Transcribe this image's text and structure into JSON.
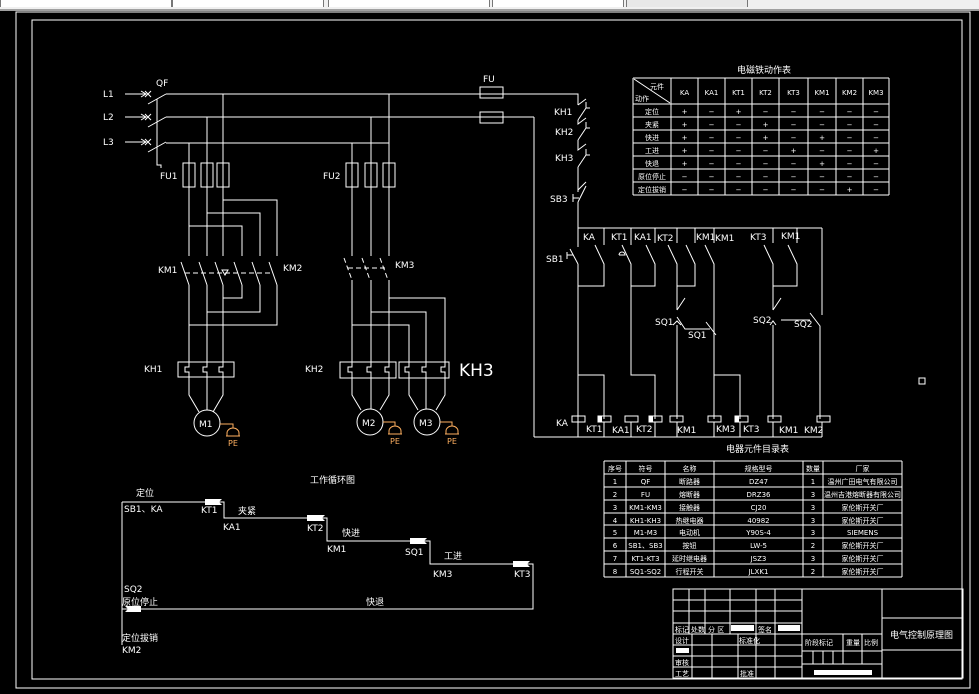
{
  "colors": {
    "background": "#000000",
    "lines": "#ffffff",
    "earth": "#ffb060",
    "toolbar": "#f0f0f0"
  },
  "power_circuit": {
    "L1": "L1",
    "L2": "L2",
    "L3": "L3",
    "QF": "QF",
    "FU1": "FU1",
    "FU2": "FU2",
    "FU": "FU",
    "KM1": "KM1",
    "KM2": "KM2",
    "KM3": "KM3",
    "KH1": "KH1",
    "KH2": "KH2",
    "KH3": "KH3",
    "M1": "M1",
    "M2": "M2",
    "M3": "M3",
    "PE": "PE"
  },
  "control_circuit": {
    "KH1": "KH1",
    "KH2": "KH2",
    "KH3": "KH3",
    "SB3": "SB3",
    "SB1": "SB1",
    "top_contacts": [
      "KA",
      "KT1",
      "KA1",
      "KT2",
      "KM1",
      "KM1",
      "KT3",
      "KM1"
    ],
    "SQ1": "SQ1",
    "SQ1b": "SQ1",
    "SQ2": "SQ2",
    "SQ2b": "SQ2",
    "coils": [
      "KA",
      "KT1",
      "KA1",
      "KT2",
      "KM1",
      "KM3",
      "KT3",
      "KM1",
      "KM2"
    ]
  },
  "cycle_diagram": {
    "title": "工作循环图",
    "labels": {
      "s1": "定位",
      "s1_in": "SB1、KA",
      "s1_out": "KT1",
      "s2": "夹紧",
      "s2_in": "KA1",
      "s2_out": "KT2",
      "s3": "快进",
      "s3_in": "KM1",
      "s3_out": "SQ1",
      "s4": "工进",
      "s4_in": "KM3",
      "s4_out": "KT3",
      "ret_in": "SQ2",
      "stop": "原位停止",
      "ret": "快退",
      "pull": "定位拔销",
      "pull_in": "KM2"
    }
  },
  "action_table": {
    "title": "电磁铁动作表",
    "corner_top": "元件",
    "corner_bottom": "动作",
    "columns": [
      "KA",
      "KA1",
      "KT1",
      "KT2",
      "KT3",
      "KM1",
      "KM2",
      "KM3"
    ],
    "rows": [
      {
        "action": "定位",
        "values": [
          "+",
          "−",
          "+",
          "−",
          "−",
          "−",
          "−",
          "−"
        ]
      },
      {
        "action": "夹紧",
        "values": [
          "+",
          "−",
          "−",
          "+",
          "−",
          "−",
          "−",
          "−"
        ]
      },
      {
        "action": "快进",
        "values": [
          "+",
          "−",
          "−",
          "+",
          "−",
          "+",
          "−",
          "−"
        ]
      },
      {
        "action": "工进",
        "values": [
          "+",
          "−",
          "−",
          "−",
          "+",
          "−",
          "−",
          "+"
        ]
      },
      {
        "action": "快退",
        "values": [
          "+",
          "−",
          "−",
          "−",
          "−",
          "+",
          "−",
          "−"
        ]
      },
      {
        "action": "原位停止",
        "values": [
          "−",
          "−",
          "−",
          "−",
          "−",
          "−",
          "−",
          "−"
        ]
      },
      {
        "action": "定位拔销",
        "values": [
          "−",
          "−",
          "−",
          "−",
          "−",
          "−",
          "+",
          "−"
        ]
      }
    ]
  },
  "parts_table": {
    "title": "电器元件目录表",
    "columns": [
      "序号",
      "符号",
      "名称",
      "规格型号",
      "数量",
      "厂家"
    ],
    "rows": [
      [
        "1",
        "QF",
        "断路器",
        "DZ47",
        "1",
        "温州广田电气有限公司"
      ],
      [
        "2",
        "FU",
        "熔断器",
        "DRZ36",
        "3",
        "温州吉港熔断器有限公司"
      ],
      [
        "3",
        "KM1-KM3",
        "接触器",
        "CJ20",
        "3",
        "家伦斯开关厂"
      ],
      [
        "4",
        "KH1-KH3",
        "热继电器",
        "40982",
        "3",
        "家伦斯开关厂"
      ],
      [
        "5",
        "M1-M3",
        "电动机",
        "Y90S-4",
        "3",
        "SIEMENS"
      ],
      [
        "6",
        "SB1、SB3",
        "按钮",
        "LW-5",
        "2",
        "家伦斯开关厂"
      ],
      [
        "7",
        "KT1-KT3",
        "延时继电器",
        "JSZ3",
        "3",
        "家伦斯开关厂"
      ],
      [
        "8",
        "SQ1-SQ2",
        "行程开关",
        "JLXK1",
        "2",
        "家伦斯开关厂"
      ]
    ]
  },
  "title_block": {
    "mark": "标记",
    "count": "处数",
    "zone": "分 区",
    "sign": "签名",
    "design": "设计",
    "standard": "标准化",
    "review": "审核",
    "process": "工艺",
    "approve": "批准",
    "stage": "阶段标记",
    "weight": "重量",
    "scale": "比例",
    "drawing_title": "电气控制原理图"
  }
}
